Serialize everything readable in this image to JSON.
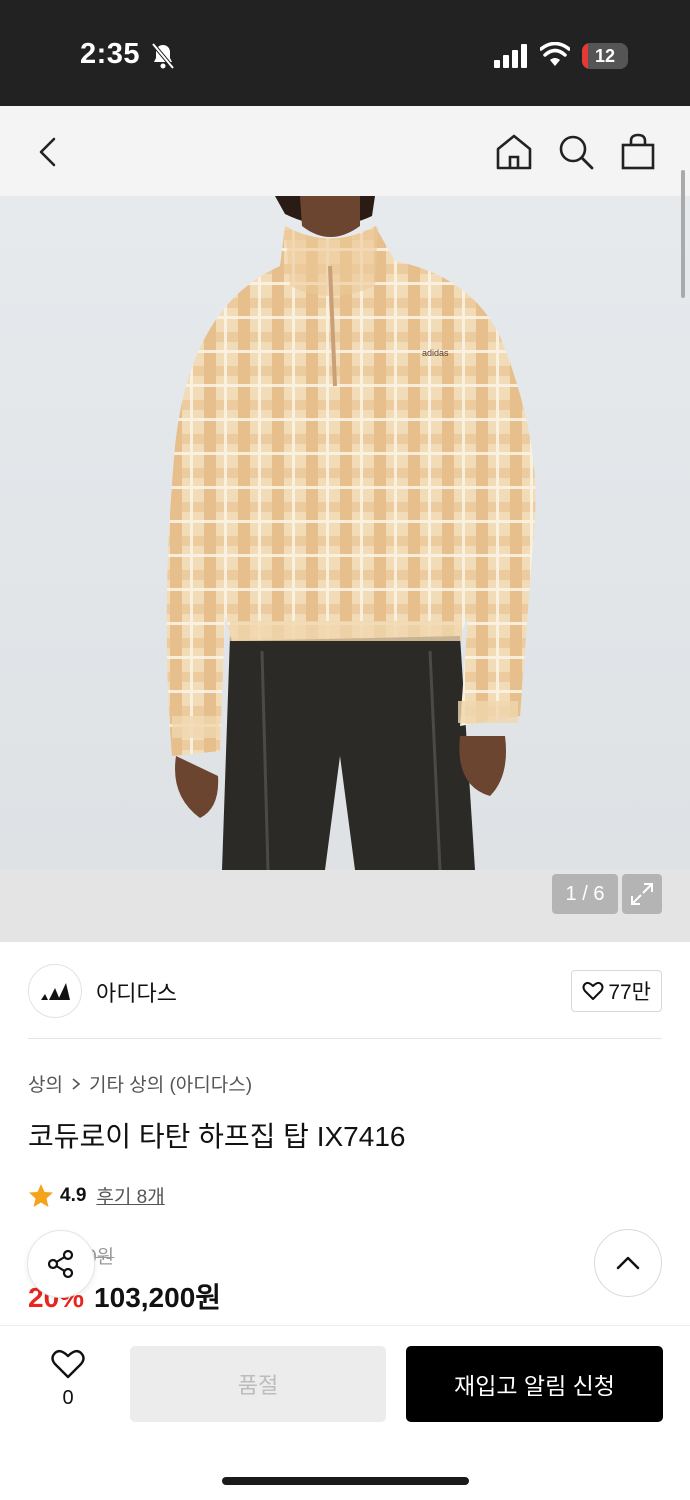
{
  "status_bar": {
    "time": "2:35",
    "battery_level": "12",
    "battery_percent": 12,
    "battery_color": "#e53935"
  },
  "nav": {
    "back_icon": "chevron-left-icon",
    "home_icon": "home-icon",
    "search_icon": "search-icon",
    "cart_icon": "shopping-bag-icon"
  },
  "gallery": {
    "counter": "1 / 6",
    "expand_icon": "expand-icon"
  },
  "brand": {
    "name": "아디다스",
    "likes": "77만"
  },
  "product": {
    "breadcrumb": [
      "상의",
      "기타 상의 (아디다스)"
    ],
    "title": "코듀로이 타탄 하프집 탑 IX7416",
    "rating": "4.9",
    "review_label": "후기 8개",
    "original_price": "129,000원",
    "discount": "20%",
    "price": "103,200원",
    "discount_color": "#e8251f"
  },
  "bottom_bar": {
    "wish_count": "0",
    "soldout_label": "품절",
    "restock_label": "재입고 알림 신청"
  }
}
